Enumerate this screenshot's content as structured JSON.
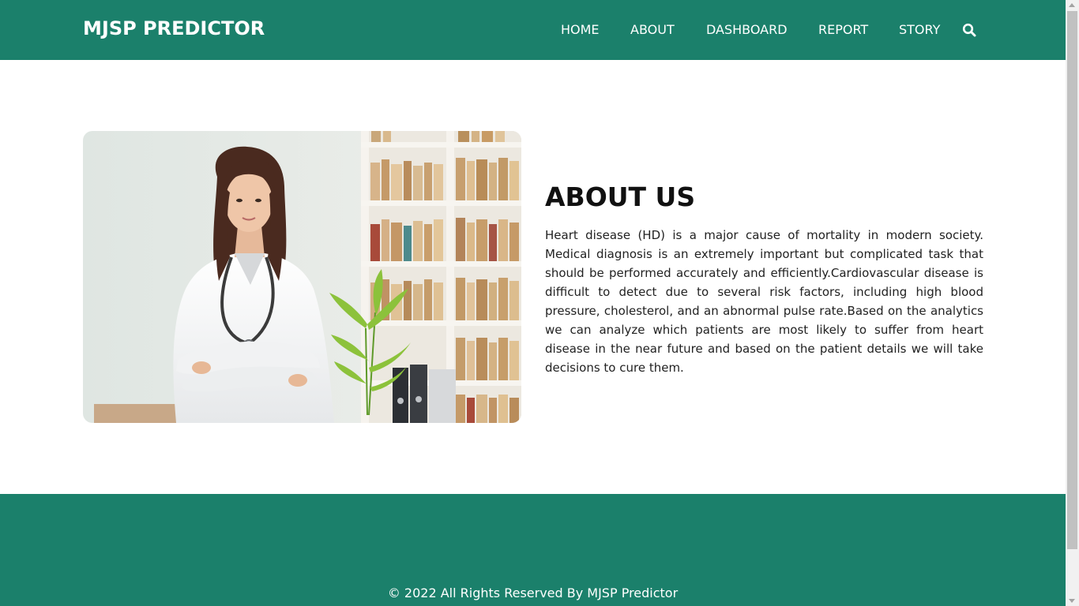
{
  "header": {
    "brand": "MJSP PREDICTOR",
    "nav": {
      "home": "HOME",
      "about": "ABOUT",
      "dashboard": "DASHBOARD",
      "report": "REPORT",
      "story": "STORY"
    },
    "search_icon": "search-icon"
  },
  "about": {
    "title": "ABOUT US",
    "body": "Heart disease (HD) is a major cause of mortality in modern society. Medical diagnosis is an extremely important but complicated task that should be performed accurately and efficiently.Cardiovascular disease is difficult to detect due to several risk factors, including high blood pressure, cholesterol, and an abnormal pulse rate.Based on the analytics we can analyze which patients are most likely to suffer from heart disease in the near future and based on the patient details we will take decisions to cure them."
  },
  "footer": {
    "copyright": "© 2022 All Rights Reserved By MJSP Predictor"
  },
  "colors": {
    "primary": "#1b806b",
    "text": "#222222",
    "white": "#ffffff"
  }
}
